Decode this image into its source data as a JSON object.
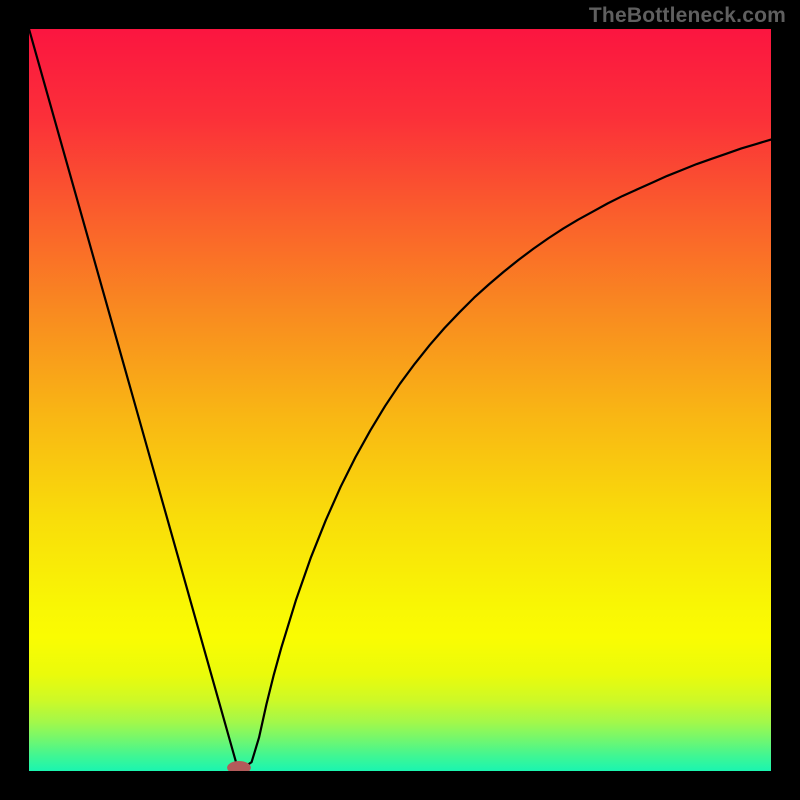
{
  "watermark": "TheBottleneck.com",
  "chart_data": {
    "type": "line",
    "xlim": [
      0,
      100
    ],
    "ylim": [
      0,
      100
    ],
    "title": "",
    "xlabel": "",
    "ylabel": "",
    "series": [
      {
        "name": "curve",
        "color": "#000000",
        "x": [
          0,
          2,
          4,
          6,
          8,
          10,
          12,
          14,
          16,
          18,
          20,
          22,
          24,
          25,
          26,
          27,
          28,
          29,
          30,
          31,
          32,
          33,
          34,
          36,
          38,
          40,
          42,
          44,
          46,
          48,
          50,
          52,
          54,
          56,
          58,
          60,
          62,
          64,
          66,
          68,
          70,
          72,
          74,
          76,
          78,
          80,
          82,
          84,
          86,
          88,
          90,
          92,
          94,
          96,
          98,
          100
        ],
        "y": [
          100,
          92.92,
          85.83,
          78.75,
          71.67,
          64.58,
          57.5,
          50.42,
          43.33,
          36.25,
          29.17,
          22.08,
          15.0,
          11.46,
          7.92,
          4.38,
          0.83,
          0.5,
          1.2,
          4.5,
          9.0,
          13.0,
          16.6,
          23.1,
          28.8,
          33.8,
          38.3,
          42.3,
          45.9,
          49.2,
          52.2,
          54.9,
          57.4,
          59.7,
          61.8,
          63.8,
          65.6,
          67.3,
          68.9,
          70.4,
          71.8,
          73.1,
          74.3,
          75.4,
          76.5,
          77.5,
          78.4,
          79.3,
          80.2,
          81.0,
          81.8,
          82.5,
          83.2,
          83.9,
          84.5,
          85.1
        ]
      }
    ],
    "marker": {
      "x": 28.3,
      "y": 0.45,
      "rx_data": 1.6,
      "ry_data": 0.9,
      "fill": "#b35a5a"
    },
    "background_gradient": {
      "stops": [
        {
          "offset": 0.0,
          "color": "#fb1540"
        },
        {
          "offset": 0.12,
          "color": "#fb3039"
        },
        {
          "offset": 0.25,
          "color": "#fa5e2c"
        },
        {
          "offset": 0.38,
          "color": "#f98a20"
        },
        {
          "offset": 0.52,
          "color": "#f9b614"
        },
        {
          "offset": 0.66,
          "color": "#f9dd0a"
        },
        {
          "offset": 0.78,
          "color": "#f9f704"
        },
        {
          "offset": 0.82,
          "color": "#fafc02"
        },
        {
          "offset": 0.87,
          "color": "#eafb0b"
        },
        {
          "offset": 0.905,
          "color": "#cdf927"
        },
        {
          "offset": 0.935,
          "color": "#a1f84b"
        },
        {
          "offset": 0.96,
          "color": "#6cf773"
        },
        {
          "offset": 0.98,
          "color": "#3ff694"
        },
        {
          "offset": 1.0,
          "color": "#1af5b0"
        }
      ]
    }
  }
}
